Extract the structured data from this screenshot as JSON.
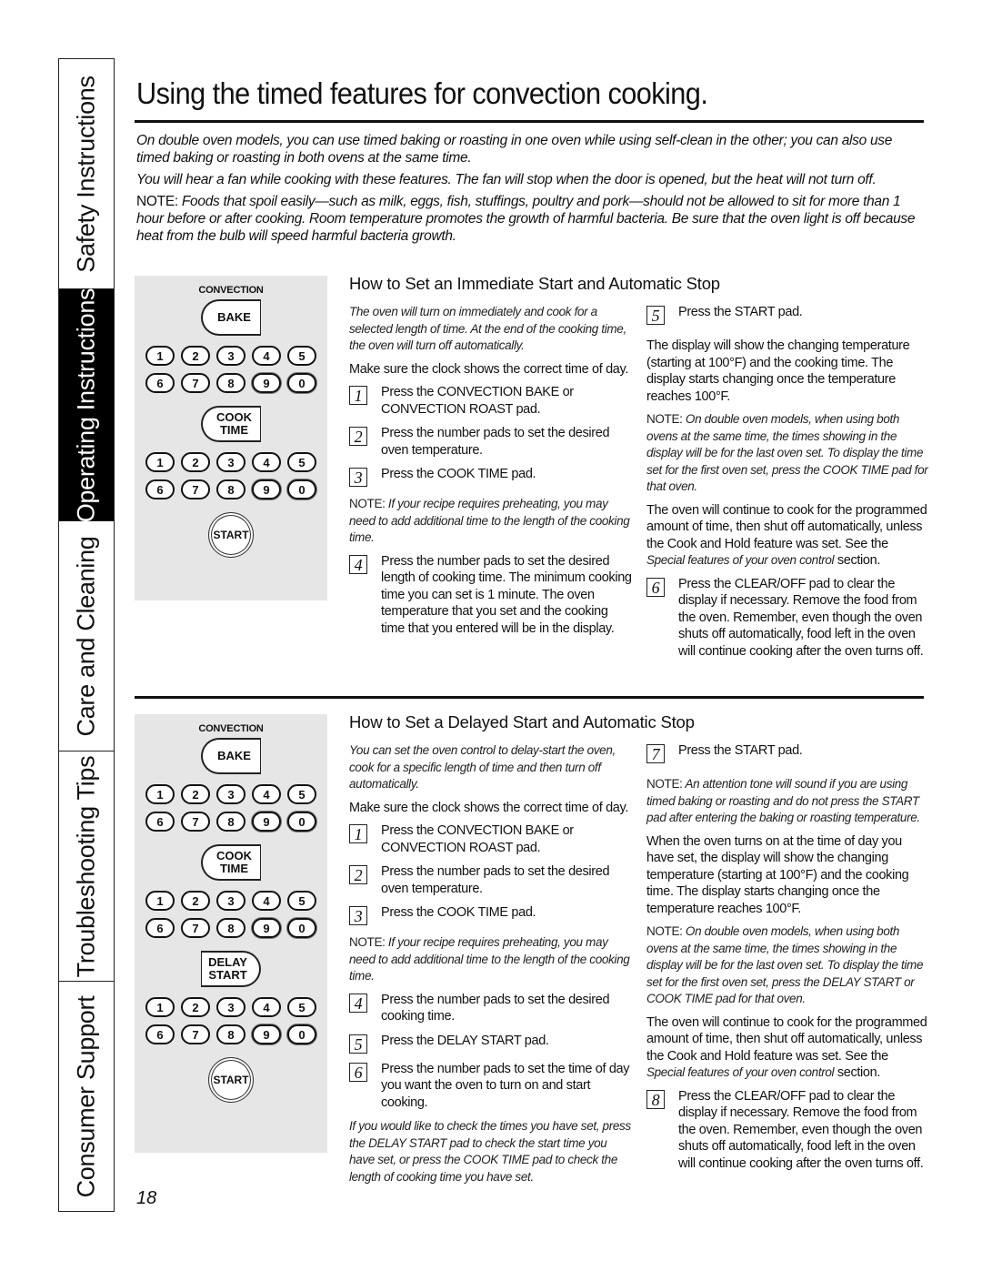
{
  "side_tabs": [
    {
      "label": "Safety Instructions",
      "active": false
    },
    {
      "label": "Operating Instructions",
      "active": true
    },
    {
      "label": "Care and Cleaning",
      "active": false
    },
    {
      "label": "Troubleshooting Tips",
      "active": false
    },
    {
      "label": "Consumer Support",
      "active": false
    }
  ],
  "header": {
    "title": "Using the timed features for convection cooking."
  },
  "intro": {
    "p1": "On double oven models, you can use timed baking or roasting in one oven while using self-clean in the other; you can also use timed baking or roasting in both ovens at the same time.",
    "p2": "You will hear a fan while cooking with these features. The fan will stop when the door is opened, but the heat will not turn off.",
    "note_label": "NOTE:",
    "note_text": " Foods that spoil easily—such as milk, eggs, fish, stuffings, poultry and pork—should not be allowed to sit for more than 1 hour before or after cooking. Room temperature promotes the growth of harmful bacteria. Be sure that the oven light is off because heat from the bulb will speed harmful bacteria growth."
  },
  "panel": {
    "convection_label": "CONVECTION",
    "bake": "BAKE",
    "cook_time_1": "COOK",
    "cook_time_2": "TIME",
    "delay_start_1": "DELAY",
    "delay_start_2": "START",
    "start": "START",
    "digits_row1": [
      "1",
      "2",
      "3",
      "4",
      "5"
    ],
    "digits_row2": [
      "6",
      "7",
      "8",
      "9",
      "0"
    ]
  },
  "immediate": {
    "title": "How to Set an Immediate Start and Automatic Stop",
    "intro": "The oven will turn on immediately and cook for a selected length of time. At the end of the cooking time, the oven will turn off automatically.",
    "clock": "Make sure the clock shows the correct time of day.",
    "step1": "Press the CONVECTION BAKE or CONVECTION ROAST pad.",
    "step2": "Press the number pads to set the desired oven temperature.",
    "step3": "Press the COOK TIME pad.",
    "note1_label": "NOTE:",
    "note1_text": " If your recipe requires preheating, you may need to add additional time to the length of the cooking time.",
    "step4": "Press the number pads to set the desired length of cooking time. The minimum cooking time you can set is 1 minute. The oven temperature that you set and the cooking time that you entered will be in the display.",
    "step5": "Press the START pad.",
    "display": "The display will show the changing temperature (starting at 100°F) and the cooking time. The display starts changing once the temperature reaches 100°F.",
    "note2_label": "NOTE:",
    "note2_text": " On double oven models, when using both ovens at the same time, the times showing in the display will be for the last oven set. To display the time set for the first oven set, press the COOK TIME pad for that oven.",
    "continue_a": "The oven will continue to cook for the programmed amount of time, then shut off automatically, unless the Cook and Hold feature was set. See the ",
    "continue_ref": "Special features of your oven control",
    "continue_b": " section.",
    "step6": "Press the CLEAR/OFF pad to clear the display if necessary. Remove the food from the oven. Remember, even though the oven shuts off automatically, food left in the oven will continue cooking after the oven turns off."
  },
  "delayed": {
    "title": "How to Set a Delayed Start and Automatic Stop",
    "intro": "You can set the oven control to delay-start the oven, cook for a specific length of time and then turn off automatically.",
    "clock": "Make sure the clock shows the correct time of day.",
    "step1": "Press the CONVECTION BAKE or CONVECTION ROAST pad.",
    "step2": "Press the number pads to set the desired oven temperature.",
    "step3": "Press the COOK TIME pad.",
    "note1_label": "NOTE:",
    "note1_text": " If your recipe requires preheating, you may need to add additional time to the length of the cooking time.",
    "step4": "Press the number pads to set the desired cooking time.",
    "step5": "Press the DELAY START pad.",
    "step6": "Press the number pads to set the time of day you want the oven to turn on and start cooking.",
    "check": "If you would like to check the times you have set, press the DELAY START pad to check the start time you have set, or press the COOK TIME pad to check the length of cooking time you have set.",
    "step7": "Press the START pad.",
    "note2_label": "NOTE:",
    "note2_text": " An attention tone will sound if you are using timed baking or roasting and do not press the START pad after entering the baking or roasting temperature.",
    "display": "When the oven turns on at the time of day you have set, the display will show the changing temperature (starting at 100°F) and the cooking time. The display starts changing once the temperature reaches 100°F.",
    "note3_label": "NOTE:",
    "note3_text": " On double oven models, when using both ovens at the same time, the times showing in the display will be for the last oven set. To display the time set for the first oven set, press the DELAY START or COOK TIME pad for that oven.",
    "continue_a": "The oven will continue to cook for the programmed amount of time, then shut off automatically, unless the Cook and Hold feature was set. See the ",
    "continue_ref": "Special features of your oven control",
    "continue_b": " section.",
    "step8": "Press the CLEAR/OFF pad to clear the display if necessary. Remove the food from the oven. Remember, even though the oven shuts off automatically, food left in the oven will continue cooking after the oven turns off."
  },
  "page_number": "18"
}
